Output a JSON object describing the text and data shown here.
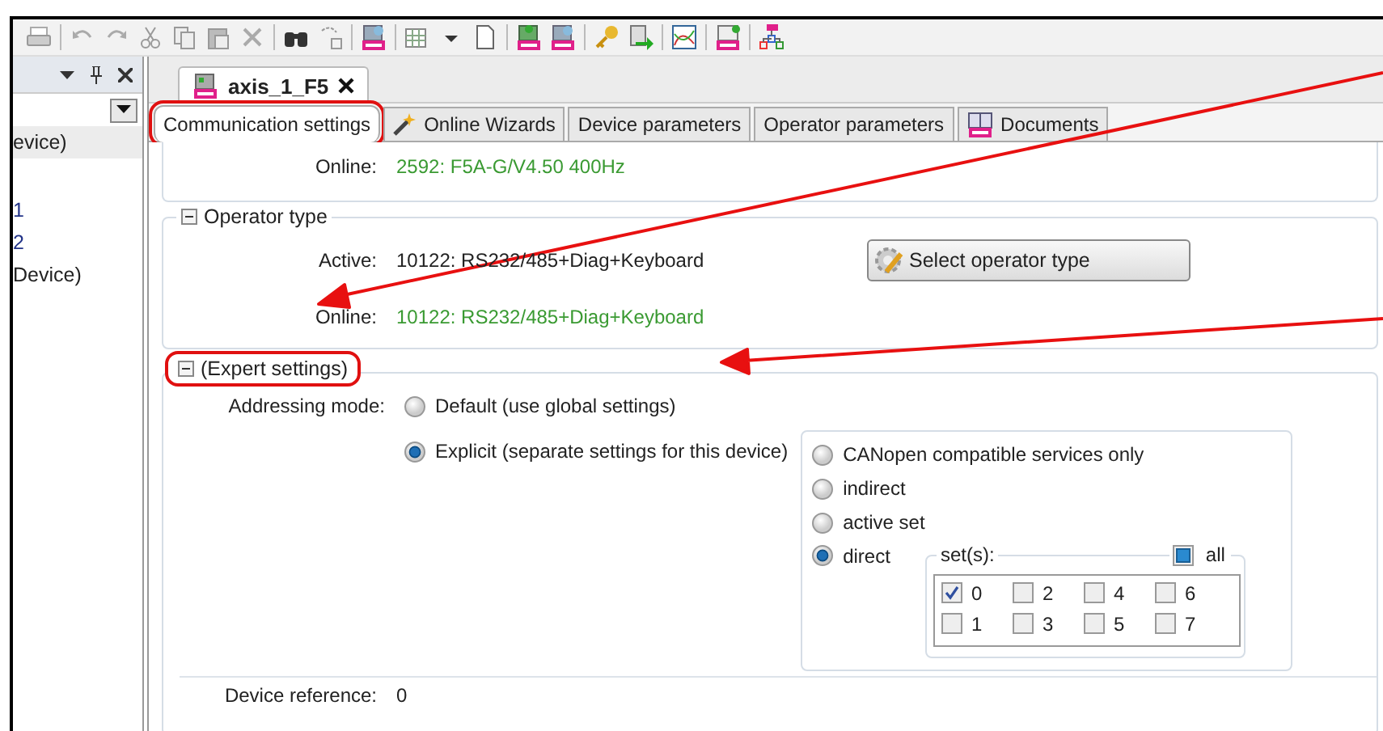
{
  "side_panel": {
    "items": [
      {
        "label": "evice)",
        "selected": true
      },
      {
        "label": "1",
        "selected": false
      },
      {
        "label": "2",
        "selected": false
      },
      {
        "label": "Device)",
        "selected": false
      }
    ]
  },
  "document_tab": {
    "title": "axis_1_F5"
  },
  "tabs": [
    {
      "label": "Communication settings",
      "selected": true,
      "highlighted": true,
      "kind": "plain"
    },
    {
      "label": "Online Wizards",
      "selected": false,
      "highlighted": false,
      "kind": "wizard"
    },
    {
      "label": "Device parameters",
      "selected": false,
      "highlighted": false,
      "kind": "plain"
    },
    {
      "label": "Operator parameters",
      "selected": false,
      "highlighted": false,
      "kind": "plain"
    },
    {
      "label": "Documents",
      "selected": false,
      "highlighted": false,
      "kind": "documents"
    }
  ],
  "device": {
    "online_label": "Online:",
    "online_value": "2592: F5A-G/V4.50 400Hz"
  },
  "operator_type": {
    "title": "Operator type",
    "expanded": true,
    "active_label": "Active:",
    "active_value": "10122: RS232/485+Diag+Keyboard",
    "button": "Select operator type",
    "online_label": "Online:",
    "online_value": "10122: RS232/485+Diag+Keyboard"
  },
  "expert_settings": {
    "title": "(Expert settings)",
    "expanded": true,
    "highlighted": true,
    "addressing_label": "Addressing mode:",
    "modes": [
      {
        "label": "Default (use global settings)",
        "selected": false
      },
      {
        "label": "Explicit (separate settings for this device)",
        "selected": true
      }
    ],
    "services": [
      {
        "label": "CANopen compatible services only",
        "selected": false
      },
      {
        "label": "indirect",
        "selected": false
      },
      {
        "label": "active set",
        "selected": false
      },
      {
        "label": "direct",
        "selected": true
      }
    ],
    "sets": {
      "label": "set(s):",
      "all_label": "all",
      "all_partial": true,
      "boxes": [
        {
          "label": "0",
          "checked": true
        },
        {
          "label": "1",
          "checked": false
        },
        {
          "label": "2",
          "checked": false
        },
        {
          "label": "3",
          "checked": false
        },
        {
          "label": "4",
          "checked": false
        },
        {
          "label": "5",
          "checked": false
        },
        {
          "label": "6",
          "checked": false
        },
        {
          "label": "7",
          "checked": false
        }
      ]
    }
  },
  "device_reference": {
    "label": "Device reference:",
    "value": "0"
  }
}
